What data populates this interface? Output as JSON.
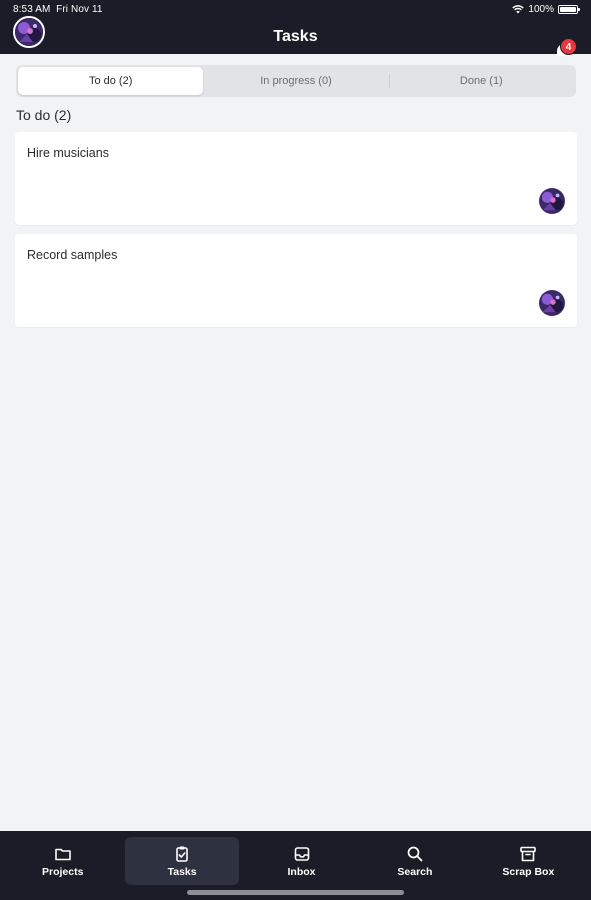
{
  "status_bar": {
    "time": "8:53 AM",
    "date": "Fri Nov 11",
    "battery": "100%",
    "wifi_icon": "wifi-icon",
    "battery_icon": "battery-icon"
  },
  "header": {
    "title": "Tasks",
    "notification_count": "4"
  },
  "segments": {
    "todo": "To do (2)",
    "in_progress": "In progress (0)",
    "done": "Done (1)"
  },
  "section": {
    "title": "To do (2)"
  },
  "tasks": [
    {
      "title": "Hire musicians"
    },
    {
      "title": "Record samples"
    }
  ],
  "tabbar": {
    "projects": "Projects",
    "tasks": "Tasks",
    "inbox": "Inbox",
    "search": "Search",
    "scrap_box": "Scrap Box"
  },
  "colors": {
    "bar_bg": "#1b1c27",
    "page_bg": "#f2f3f5",
    "badge": "#e5393c",
    "active_tab_bg": "#2e3140"
  }
}
